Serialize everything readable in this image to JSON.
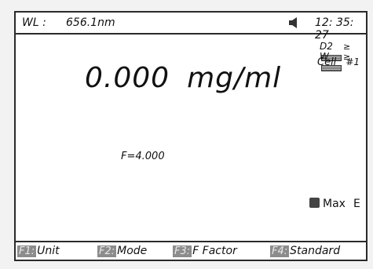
{
  "status": {
    "wl_label": "WL :",
    "wl_value": "656.1nm",
    "speaker_icon": "speaker-icon",
    "time": "12: 35: 27"
  },
  "measurement": {
    "value": "0.000",
    "unit": "mg/ml"
  },
  "lamps": [
    {
      "label": "D2",
      "arrow": "≥"
    },
    {
      "label": "W",
      "arrow": "≥"
    }
  ],
  "cell": {
    "label": "Cell",
    "number": "#1"
  },
  "factor": "F=4.000",
  "mode_indicator": {
    "icon": "toggle-icon",
    "label": "Max",
    "value": "E"
  },
  "function_keys": [
    {
      "key": "F1:",
      "label": "Unit"
    },
    {
      "key": "F2:",
      "label": "Mode"
    },
    {
      "key": "F3:",
      "label": "F  Factor"
    },
    {
      "key": "F4:",
      "label": "Standard"
    }
  ]
}
